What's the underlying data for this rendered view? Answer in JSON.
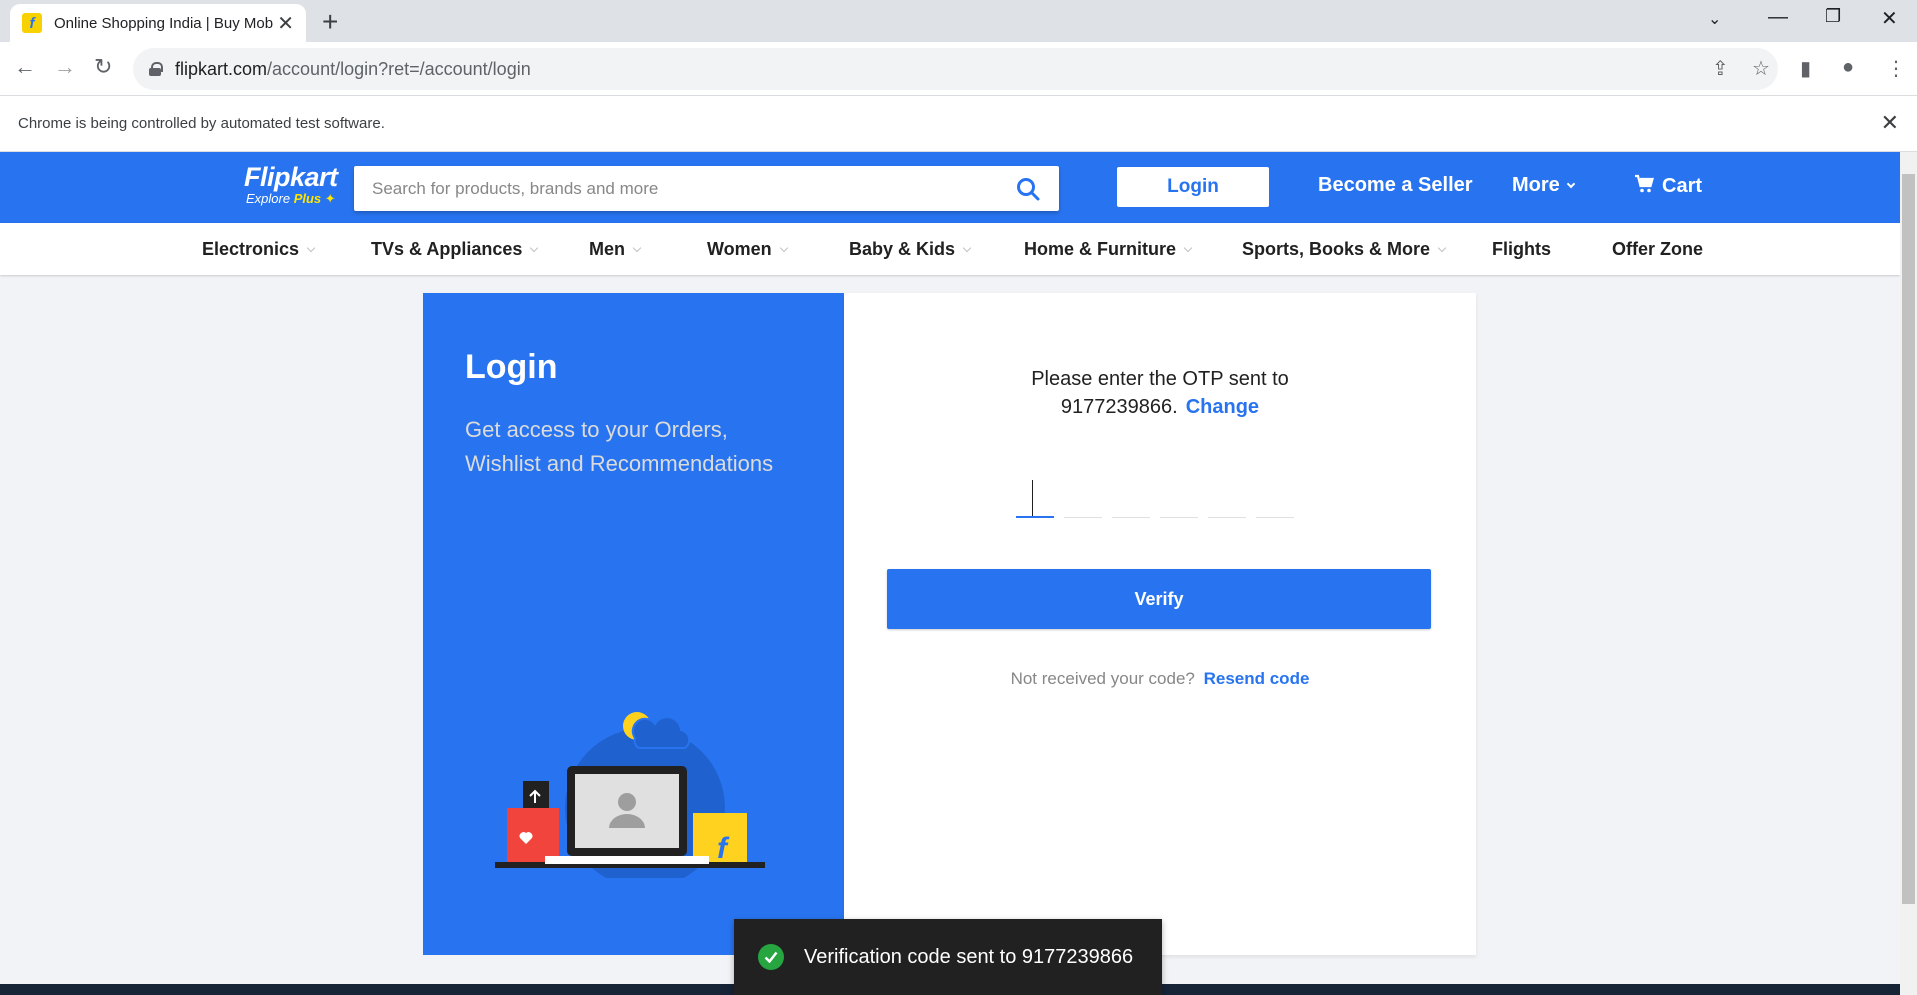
{
  "browser": {
    "tab_title": "Online Shopping India | Buy Mob",
    "url_host": "flipkart.com",
    "url_path": "/account/login?ret=/account/login",
    "infobar_text": "Chrome is being controlled by automated test software."
  },
  "header": {
    "logo_text": "Flipkart",
    "logo_sub": "Explore",
    "logo_plus": "Plus",
    "search_placeholder": "Search for products, brands and more",
    "login_label": "Login",
    "become_seller": "Become a Seller",
    "more": "More",
    "cart": "Cart"
  },
  "categories": [
    "Electronics",
    "TVs & Appliances",
    "Men",
    "Women",
    "Baby & Kids",
    "Home & Furniture",
    "Sports, Books & More",
    "Flights",
    "Offer Zone"
  ],
  "login_panel": {
    "title": "Login",
    "subtitle": "Get access to your Orders, Wishlist and Recommendations"
  },
  "otp": {
    "prompt": "Please enter the OTP sent to",
    "phone": "9177239866.",
    "change": "Change",
    "verify": "Verify",
    "not_received": "Not received your code?",
    "resend": "Resend code"
  },
  "toast": {
    "message": "Verification code sent to 9177239866"
  },
  "colors": {
    "brand_blue": "#2874f0",
    "brand_yellow": "#ffe500",
    "success_green": "#26a541"
  }
}
